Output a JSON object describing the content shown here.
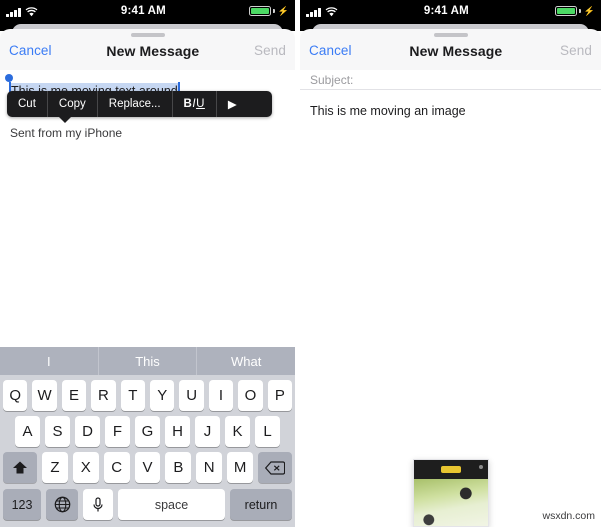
{
  "status_bar": {
    "time": "9:41 AM",
    "signal_icon": "cellular-signal-icon",
    "wifi_icon": "wifi-icon",
    "battery_icon": "battery-charging-icon",
    "battery_color": "#4cd964"
  },
  "left_panel": {
    "nav": {
      "cancel_label": "Cancel",
      "title": "New Message",
      "send_label": "Send",
      "send_disabled": true,
      "accent_color": "#3b7cf5",
      "disabled_color": "#b9b9bf"
    },
    "edit_menu": {
      "items": [
        {
          "label": "Cut",
          "name": "cut"
        },
        {
          "label": "Copy",
          "name": "copy"
        },
        {
          "label": "Replace...",
          "name": "replace"
        }
      ],
      "format_bold": "B",
      "format_italic": "I",
      "format_underline": "U",
      "more_arrow": "▶",
      "background_color": "#1c1c1e"
    },
    "selected_text": "This is me moving text around",
    "selection_highlight_color": "#c6d7f2",
    "selection_handle_color": "#2b6cdd",
    "signature": "Sent from my iPhone",
    "keyboard": {
      "predictions": [
        "I",
        "This",
        "What"
      ],
      "row1": [
        "Q",
        "W",
        "E",
        "R",
        "T",
        "Y",
        "U",
        "I",
        "O",
        "P"
      ],
      "row2": [
        "A",
        "S",
        "D",
        "F",
        "G",
        "H",
        "J",
        "K",
        "L"
      ],
      "row3": [
        "Z",
        "X",
        "C",
        "V",
        "B",
        "N",
        "M"
      ],
      "shift_icon": "shift-arrow-icon",
      "delete_icon": "backspace-delete-icon",
      "numbers_label": "123",
      "globe_icon": "globe-language-icon",
      "mic_icon": "microphone-icon",
      "space_label": "space",
      "return_label": "return"
    }
  },
  "right_panel": {
    "nav": {
      "cancel_label": "Cancel",
      "title": "New Message",
      "send_label": "Send",
      "send_disabled": true
    },
    "subject_label": "Subject:",
    "body_text": "This is me moving an image",
    "dragged_image": {
      "name": "dragged-screenshot-thumbnail",
      "description": "screenshot thumbnail being dragged"
    }
  },
  "watermark": "wsxdn.com"
}
